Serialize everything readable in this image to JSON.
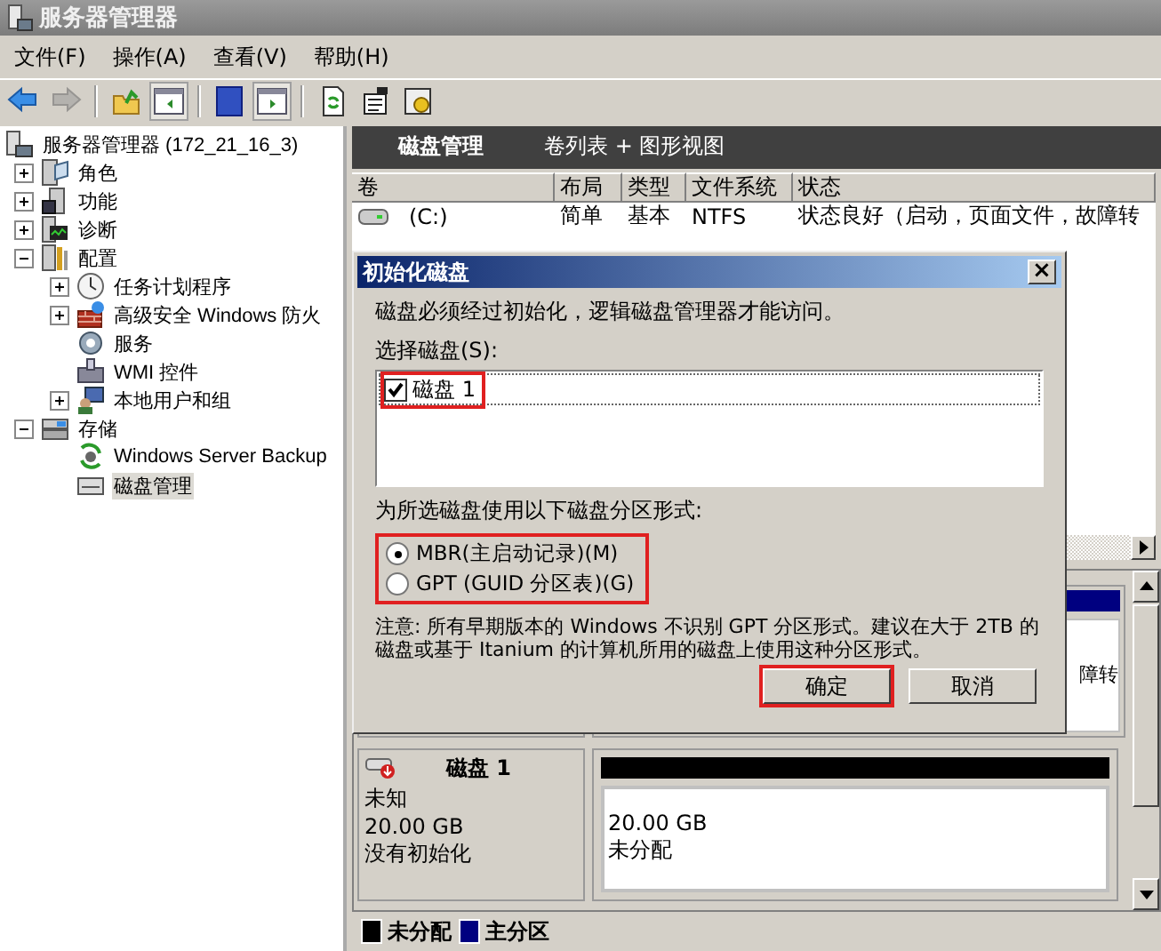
{
  "window": {
    "title": "服务器管理器"
  },
  "menu": [
    "文件(F)",
    "操作(A)",
    "查看(V)",
    "帮助(H)"
  ],
  "toolbar": [
    {
      "disabled": false,
      "pressed": false
    },
    {
      "disabled": true,
      "pressed": false
    },
    {
      "disabled": false,
      "pressed": false
    },
    {
      "disabled": false,
      "pressed": true
    },
    {
      "disabled": false,
      "pressed": false
    },
    {
      "disabled": false,
      "pressed": true
    },
    {
      "disabled": false,
      "pressed": false
    },
    {
      "disabled": false,
      "pressed": false
    },
    {
      "disabled": false,
      "pressed": false
    }
  ],
  "tree": {
    "label": "服务器管理器 (172_21_16_3)",
    "selected": false,
    "children": [
      {
        "label": "角色",
        "kind": "branch",
        "expanded": false,
        "selected": false
      },
      {
        "label": "功能",
        "kind": "branch",
        "expanded": false,
        "selected": false
      },
      {
        "label": "诊断",
        "kind": "branch",
        "expanded": false,
        "selected": false
      },
      {
        "label": "配置",
        "kind": "branch",
        "expanded": true,
        "selected": false,
        "children": [
          {
            "label": "任务计划程序",
            "kind": "branch",
            "expanded": false,
            "selected": false
          },
          {
            "label": "高级安全 Windows 防火",
            "kind": "branch",
            "expanded": false,
            "selected": false
          },
          {
            "label": "服务",
            "kind": "leaf",
            "selected": false
          },
          {
            "label": "WMI 控件",
            "kind": "leaf",
            "selected": false
          },
          {
            "label": "本地用户和组",
            "kind": "branch",
            "expanded": false,
            "selected": false
          }
        ]
      },
      {
        "label": "存储",
        "kind": "branch",
        "expanded": true,
        "selected": false,
        "children": [
          {
            "label": "Windows Server Backup",
            "kind": "leaf",
            "selected": false
          },
          {
            "label": "磁盘管理",
            "kind": "leaf",
            "selected": true
          }
        ]
      }
    ]
  },
  "header": {
    "title": "磁盘管理",
    "view": "卷列表 + 图形视图"
  },
  "volumes": {
    "columns": [
      "卷",
      "布局",
      "类型",
      "文件系统",
      "状态"
    ],
    "rows": [
      {
        "cells": [
          "(C:)",
          "简单",
          "基本",
          "NTFS",
          "状态良好（启动，页面文件，故障转"
        ]
      }
    ]
  },
  "disks": [
    {
      "partition": {
        "label": "障转",
        "color": "#000080"
      }
    },
    {
      "name": "磁盘 1",
      "type": "未知",
      "size": "20.00 GB",
      "status": "没有初始化",
      "partition": {
        "size": "20.00 GB",
        "label": "未分配",
        "color": "#000000"
      }
    }
  ],
  "legend": [
    {
      "label": "未分配",
      "color": "#000000"
    },
    {
      "label": "主分区",
      "color": "#000080"
    }
  ],
  "dialog": {
    "title": "初始化磁盘",
    "close": "×",
    "message": "磁盘必须经过初始化，逻辑磁盘管理器才能访问。",
    "select_label": "选择磁盘(S):",
    "disks": [
      {
        "label": "磁盘 1",
        "checked": true,
        "highlighted": true
      }
    ],
    "format_label": "为所选磁盘使用以下磁盘分区形式:",
    "options_highlighted": true,
    "options": [
      {
        "label": "MBR(主启动记录)(M)",
        "selected": true
      },
      {
        "label": "GPT (GUID 分区表)(G)",
        "selected": false
      }
    ],
    "note": "注意: 所有早期版本的 Windows 不识别 GPT 分区形式。建议在大于 2TB 的磁盘或基于 Itanium 的计算机所用的磁盘上使用这种分区形式。",
    "buttons": [
      {
        "label": "确定",
        "highlighted": true
      },
      {
        "label": "取消",
        "highlighted": false
      }
    ]
  }
}
